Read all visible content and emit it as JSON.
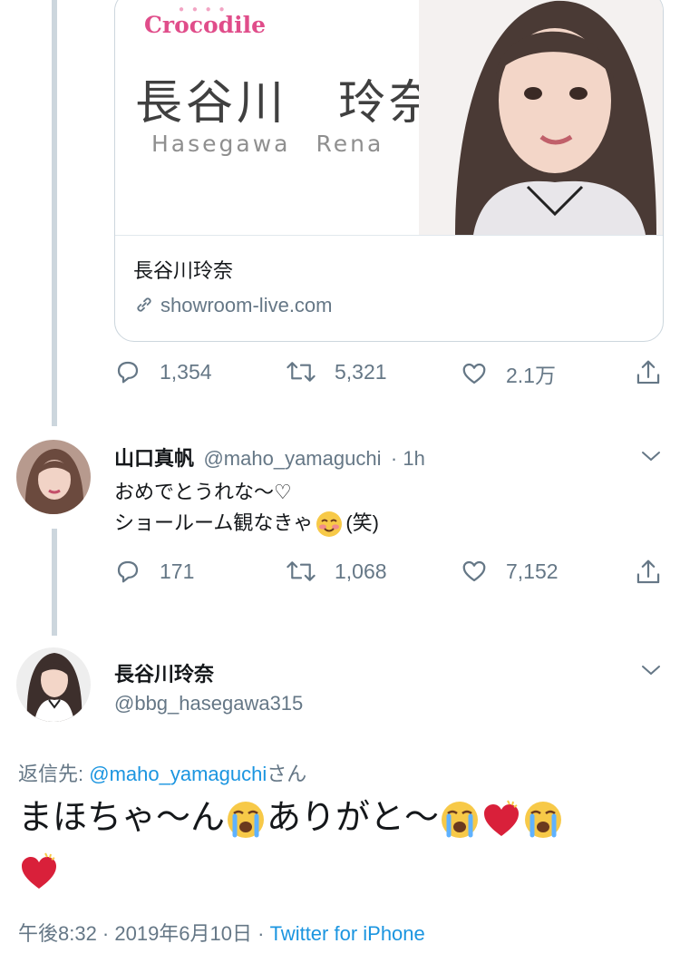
{
  "card": {
    "brand": "Crocodile",
    "name_jp": "長谷川　玲奈",
    "name_en": "Hasegawa　Rena",
    "title": "長谷川玲奈",
    "link": "showroom-live.com"
  },
  "tweet1_actions": {
    "replies": "1,354",
    "retweets": "5,321",
    "likes": "2.1万"
  },
  "reply": {
    "name": "山口真帆",
    "handle": "@maho_yamaguchi",
    "time": "· 1h",
    "line1": "おめでとうれな〜♡",
    "line2_a": "ショールーム観なきゃ",
    "line2_b": "(笑)",
    "actions": {
      "replies": "171",
      "retweets": "1,068",
      "likes": "7,152"
    }
  },
  "main": {
    "name": "長谷川玲奈",
    "handle": "@bbg_hasegawa315",
    "reply_label": "返信先: ",
    "reply_mention": "@maho_yamaguchi",
    "reply_suffix": "さん",
    "text_a": "まほちゃ〜ん",
    "text_b": "ありがと〜",
    "meta_time": "午後8:32 · 2019年6月10日 · ",
    "meta_source": "Twitter for iPhone"
  },
  "colors": {
    "accent": "#1b95e0",
    "muted": "#657786",
    "line": "#ccd6dd",
    "brand": "#e04d8a"
  },
  "icons": [
    "reply-icon",
    "retweet-icon",
    "like-icon",
    "share-icon",
    "chevron-down-icon",
    "link-icon",
    "blushing-face-emoji",
    "loudly-crying-face-emoji",
    "heart-emoji"
  ]
}
